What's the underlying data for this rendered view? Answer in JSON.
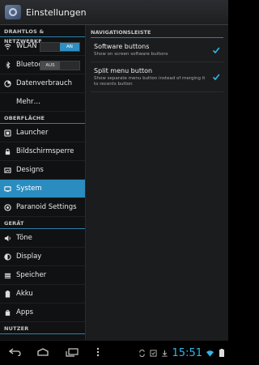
{
  "actionbar": {
    "title": "Einstellungen"
  },
  "left": {
    "sections": {
      "wireless": "DRAHTLOS & NETZWERKE",
      "interface": "OBERFLÄCHE",
      "device": "GERÄT",
      "users": "NUTZER"
    },
    "items": {
      "wlan": "WLAN",
      "bluetooth": "Bluetooth",
      "data_usage": "Datenverbrauch",
      "more": "Mehr…",
      "launcher": "Launcher",
      "lockscreen": "Bildschirmsperre",
      "designs": "Designs",
      "system": "System",
      "paranoid": "Paranoid Settings",
      "sounds": "Töne",
      "display": "Display",
      "storage": "Speicher",
      "battery": "Akku",
      "apps": "Apps"
    },
    "toggles": {
      "wlan_state": "AN",
      "bluetooth_state": "AUS"
    }
  },
  "right": {
    "header": "NAVIGATIONSLEISTE",
    "prefs": [
      {
        "title": "Software buttons",
        "summary": "Show on screen software buttons",
        "checked": true
      },
      {
        "title": "Split menu button",
        "summary": "Show separate menu button instead of merging it to recents button",
        "checked": true
      }
    ]
  },
  "statusbar": {
    "time": "15:51"
  },
  "colors": {
    "accent": "#2a8cbf",
    "clock": "#31b6e7"
  }
}
